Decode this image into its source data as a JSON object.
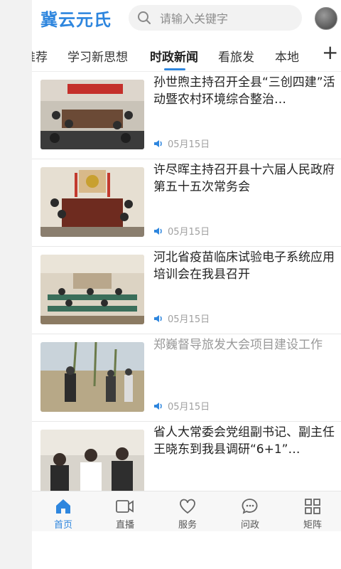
{
  "header": {
    "logo_text": "冀云元氏",
    "search_placeholder": "请输入关键字",
    "search_icon": "search-icon",
    "avatar_icon": "avatar"
  },
  "tabs": [
    {
      "label": "推荐"
    },
    {
      "label": "学习新思想"
    },
    {
      "label": "时政新闻",
      "active": true
    },
    {
      "label": "看旅发"
    },
    {
      "label": "本地"
    }
  ],
  "tabs_more_label": "+",
  "news": [
    {
      "title": "孙世煦主持召开全县“三创四建”活动暨农村环境综合整治…",
      "date": "05月15日",
      "read": false
    },
    {
      "title": "许尽晖主持召开县十六届人民政府第五十五次常务会",
      "date": "05月15日",
      "read": false
    },
    {
      "title": "河北省疫苗临床试验电子系统应用培训会在我县召开",
      "date": "05月15日",
      "read": false
    },
    {
      "title": "郑巍督导旅发大会项目建设工作",
      "date": "05月15日",
      "read": true
    },
    {
      "title": "省人大常委会党组副书记、副主任王晓东到我县调研“6+1”…",
      "date": "",
      "read": false
    }
  ],
  "bottom_nav": [
    {
      "label": "首页",
      "icon": "home-icon",
      "active": true
    },
    {
      "label": "直播",
      "icon": "video-icon"
    },
    {
      "label": "服务",
      "icon": "heart-icon"
    },
    {
      "label": "问政",
      "icon": "chat-icon"
    },
    {
      "label": "矩阵",
      "icon": "grid-icon"
    }
  ],
  "colors": {
    "accent": "#2e86de",
    "text": "#222222",
    "muted": "#a0a0a0"
  }
}
